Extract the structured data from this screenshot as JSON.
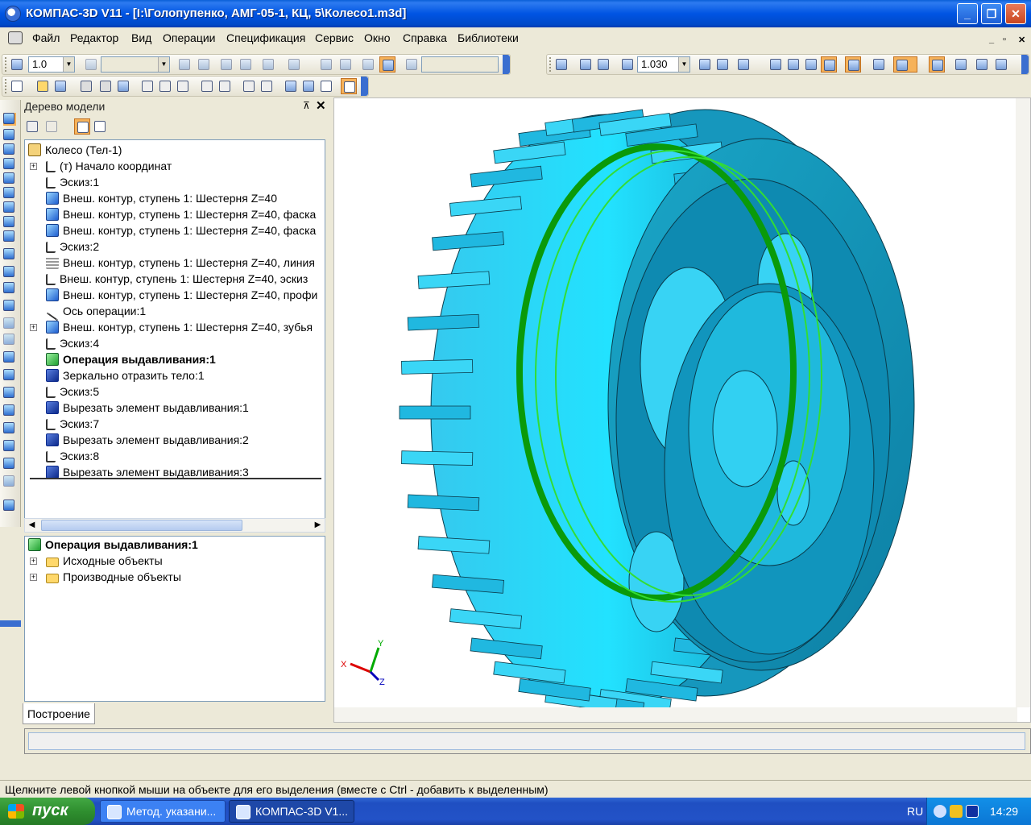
{
  "window": {
    "title": "КОМПАС-3D V11 - [I:\\Голопупенко, АМГ-05-1, КЦ, 5\\Колесо1.m3d]",
    "min_label": "_",
    "max_label": "❐",
    "close_label": "✕"
  },
  "menu": {
    "items": [
      "Файл",
      "Редактор",
      "Вид",
      "Операции",
      "Спецификация",
      "Сервис",
      "Окно",
      "Справка",
      "Библиотеки"
    ],
    "mdi_min": "_",
    "mdi_restore": "▫",
    "mdi_close": "✕"
  },
  "toolbar": {
    "scale_value": "1.0",
    "zoom_value": "1.030"
  },
  "tree": {
    "title": "Дерево модели",
    "pin": "⊼",
    "close": "✕",
    "rows": [
      {
        "text": "Колесо (Тел-1)",
        "icon": "part-icon",
        "expander": "",
        "bold": false
      },
      {
        "text": "(т) Начало координат",
        "icon": "origin-icon",
        "expander": "+",
        "bold": false
      },
      {
        "text": "Эскиз:1",
        "icon": "sketch-icon",
        "expander": "",
        "bold": false
      },
      {
        "text": "Внеш. контур, ступень 1: Шестерня Z=40",
        "icon": "solid-icon",
        "expander": "",
        "bold": false
      },
      {
        "text": "Внеш. контур, ступень 1: Шестерня Z=40, фаска",
        "icon": "chamfer-icon",
        "expander": "",
        "bold": false
      },
      {
        "text": "Внеш. контур, ступень 1: Шестерня Z=40, фаска",
        "icon": "chamfer-icon",
        "expander": "",
        "bold": false
      },
      {
        "text": "Эскиз:2",
        "icon": "sketch-icon",
        "expander": "",
        "bold": false
      },
      {
        "text": "Внеш. контур, ступень 1: Шестерня Z=40, линия",
        "icon": "line-icon",
        "expander": "",
        "bold": false
      },
      {
        "text": "Внеш. контур, ступень 1: Шестерня Z=40, эскиз",
        "icon": "sketch-icon",
        "expander": "",
        "bold": false
      },
      {
        "text": "Внеш. контур, ступень 1: Шестерня Z=40, профи",
        "icon": "profile-icon",
        "expander": "",
        "bold": false
      },
      {
        "text": "Ось операции:1",
        "icon": "axis-icon",
        "expander": "",
        "bold": false
      },
      {
        "text": "Внеш. контур, ступень 1: Шестерня Z=40, зубья",
        "icon": "teeth-icon",
        "expander": "+",
        "bold": false
      },
      {
        "text": "Эскиз:4",
        "icon": "sketch-icon",
        "expander": "",
        "bold": false
      },
      {
        "text": "Операция выдавливания:1",
        "icon": "extrude-icon",
        "expander": "",
        "bold": true
      },
      {
        "text": "Зеркально отразить тело:1",
        "icon": "mirror-icon",
        "expander": "",
        "bold": false
      },
      {
        "text": "Эскиз:5",
        "icon": "sketch-icon",
        "expander": "",
        "bold": false
      },
      {
        "text": "Вырезать элемент выдавливания:1",
        "icon": "cut-icon",
        "expander": "",
        "bold": false
      },
      {
        "text": "Эскиз:7",
        "icon": "sketch-icon",
        "expander": "",
        "bold": false
      },
      {
        "text": "Вырезать элемент выдавливания:2",
        "icon": "cut-icon",
        "expander": "",
        "bold": false
      },
      {
        "text": "Эскиз:8",
        "icon": "sketch-icon",
        "expander": "",
        "bold": false
      },
      {
        "text": "Вырезать элемент выдавливания:3",
        "icon": "cut-icon",
        "expander": "",
        "bold": false
      }
    ],
    "scroll_left": "◀",
    "scroll_right": "▶",
    "tab_label": "Построение"
  },
  "properties": {
    "rows": [
      {
        "text": "Операция выдавливания:1",
        "icon": "extrude-icon",
        "expander": "",
        "bold": true
      },
      {
        "text": "Исходные объекты",
        "icon": "folder-icon",
        "expander": "+",
        "bold": false
      },
      {
        "text": "Производные объекты",
        "icon": "folder-icon",
        "expander": "+",
        "bold": false
      }
    ]
  },
  "viewport": {
    "axis_x": "X",
    "axis_y": "Y",
    "axis_z": "Z"
  },
  "status": {
    "hint": "Щелкните левой кнопкой мыши на объекте для его выделения (вместе с Ctrl - добавить к выделенным)"
  },
  "taskbar": {
    "start_label": "пуск",
    "tasks": [
      "Метод. указани...",
      "КОМПАС-3D V1..."
    ],
    "language": "RU",
    "clock": "14:29"
  }
}
